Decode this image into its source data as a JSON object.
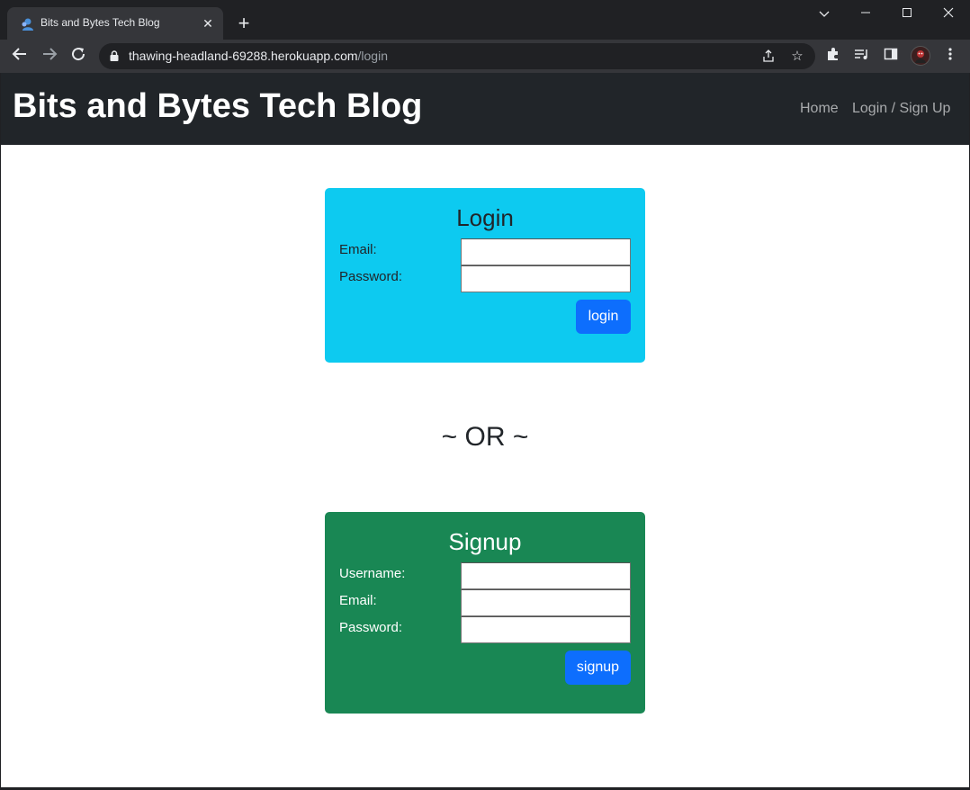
{
  "browser": {
    "tab_title": "Bits and Bytes Tech Blog",
    "url_host": "thawing-headland-69288.herokuapp.com",
    "url_path": "/login"
  },
  "navbar": {
    "brand": "Bits and Bytes Tech Blog",
    "links": [
      "Home",
      "Login / Sign Up"
    ]
  },
  "login": {
    "title": "Login",
    "email_label": "Email:",
    "email_value": "",
    "password_label": "Password:",
    "password_value": "",
    "button": "login",
    "color": "#0dcaf0"
  },
  "separator": "~ OR ~",
  "signup": {
    "title": "Signup",
    "username_label": "Username:",
    "username_value": "",
    "email_label": "Email:",
    "email_value": "",
    "password_label": "Password:",
    "password_value": "",
    "button": "signup",
    "color": "#198754"
  },
  "colors": {
    "navbar_bg": "#212529",
    "button_primary": "#0d6efd"
  }
}
